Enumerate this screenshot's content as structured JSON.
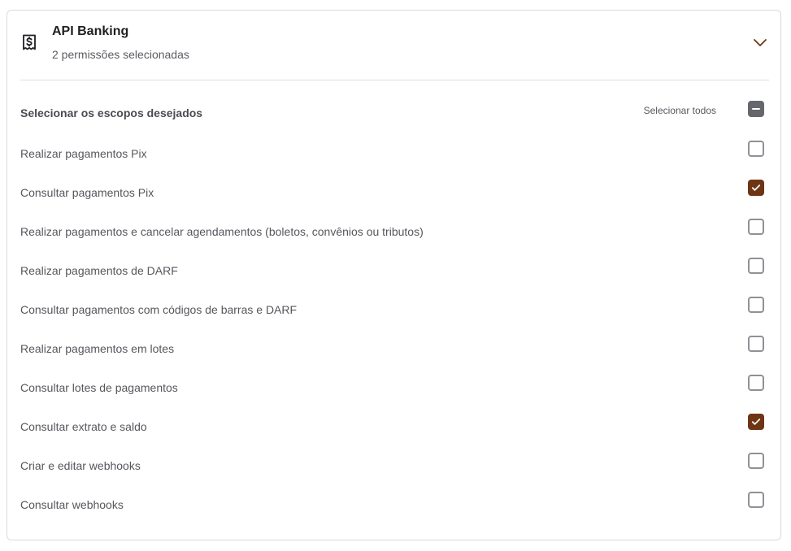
{
  "card": {
    "title": "API Banking",
    "subtitle": "2 permissões selecionadas",
    "icon": "dollar-document-icon",
    "expanded": true
  },
  "scopes": {
    "title": "Selecionar os escopos desejados",
    "select_all_label": "Selecionar todos",
    "select_all_state": "indeterminate",
    "items": [
      {
        "label": "Realizar pagamentos Pix",
        "checked": false
      },
      {
        "label": "Consultar pagamentos Pix",
        "checked": true
      },
      {
        "label": "Realizar pagamentos e cancelar agendamentos (boletos, convênios ou tributos)",
        "checked": false
      },
      {
        "label": "Realizar pagamentos de DARF",
        "checked": false
      },
      {
        "label": "Consultar pagamentos com códigos de barras e DARF",
        "checked": false
      },
      {
        "label": "Realizar pagamentos em lotes",
        "checked": false
      },
      {
        "label": "Consultar lotes de pagamentos",
        "checked": false
      },
      {
        "label": "Consultar extrato e saldo",
        "checked": true
      },
      {
        "label": "Criar e editar webhooks",
        "checked": false
      },
      {
        "label": "Consultar webhooks",
        "checked": false
      }
    ]
  },
  "colors": {
    "checked": "#6e3514",
    "indeterminate": "#65676c",
    "chevron": "#6e3514"
  }
}
